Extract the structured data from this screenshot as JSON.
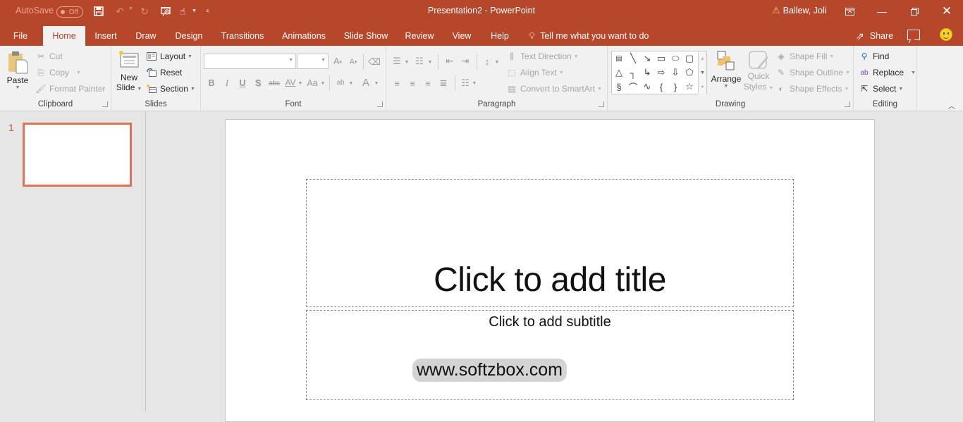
{
  "titlebar": {
    "autosave_label": "AutoSave",
    "autosave_state": "Off",
    "doc_title": "Presentation2  -  PowerPoint",
    "user_name": "Ballew, Joli",
    "icons": {
      "save": "save-icon",
      "undo": "undo-icon",
      "redo": "redo-icon",
      "present": "start-from-beginning-icon",
      "touch": "touch-mode-icon",
      "customize": "customize-qat-icon"
    }
  },
  "tabs": [
    {
      "label": "File",
      "active": false
    },
    {
      "label": "Home",
      "active": true
    },
    {
      "label": "Insert",
      "active": false
    },
    {
      "label": "Draw",
      "active": false
    },
    {
      "label": "Design",
      "active": false
    },
    {
      "label": "Transitions",
      "active": false
    },
    {
      "label": "Animations",
      "active": false
    },
    {
      "label": "Slide Show",
      "active": false
    },
    {
      "label": "Review",
      "active": false
    },
    {
      "label": "View",
      "active": false
    },
    {
      "label": "Help",
      "active": false
    }
  ],
  "tell_me": "Tell me what you want to do",
  "share_label": "Share",
  "ribbon": {
    "clipboard": {
      "label": "Clipboard",
      "paste": "Paste",
      "cut": "Cut",
      "copy": "Copy",
      "format_painter": "Format Painter"
    },
    "slides": {
      "label": "Slides",
      "new_slide_1": "New",
      "new_slide_2": "Slide",
      "layout": "Layout",
      "reset": "Reset",
      "section": "Section"
    },
    "font": {
      "label": "Font",
      "font_name": "",
      "font_size": "",
      "buttons": [
        "B",
        "I",
        "U",
        "S",
        "abc",
        "AV",
        "Aa",
        "ab",
        "A"
      ]
    },
    "paragraph": {
      "label": "Paragraph",
      "text_direction": "Text Direction",
      "align_text": "Align Text",
      "convert_smartart": "Convert to SmartArt"
    },
    "drawing": {
      "label": "Drawing",
      "arrange": "Arrange",
      "quick_styles_1": "Quick",
      "quick_styles_2": "Styles",
      "shape_fill": "Shape Fill",
      "shape_outline": "Shape Outline",
      "shape_effects": "Shape Effects"
    },
    "editing": {
      "label": "Editing",
      "find": "Find",
      "replace": "Replace",
      "select": "Select"
    }
  },
  "thumbnails": [
    {
      "number": "1",
      "selected": true
    }
  ],
  "slide": {
    "title_placeholder": "Click to add title",
    "subtitle_placeholder": "Click to add subtitle",
    "watermark": "www.softzbox.com"
  },
  "colors": {
    "accent": "#b7472a",
    "thumb_selected": "#e07256"
  }
}
